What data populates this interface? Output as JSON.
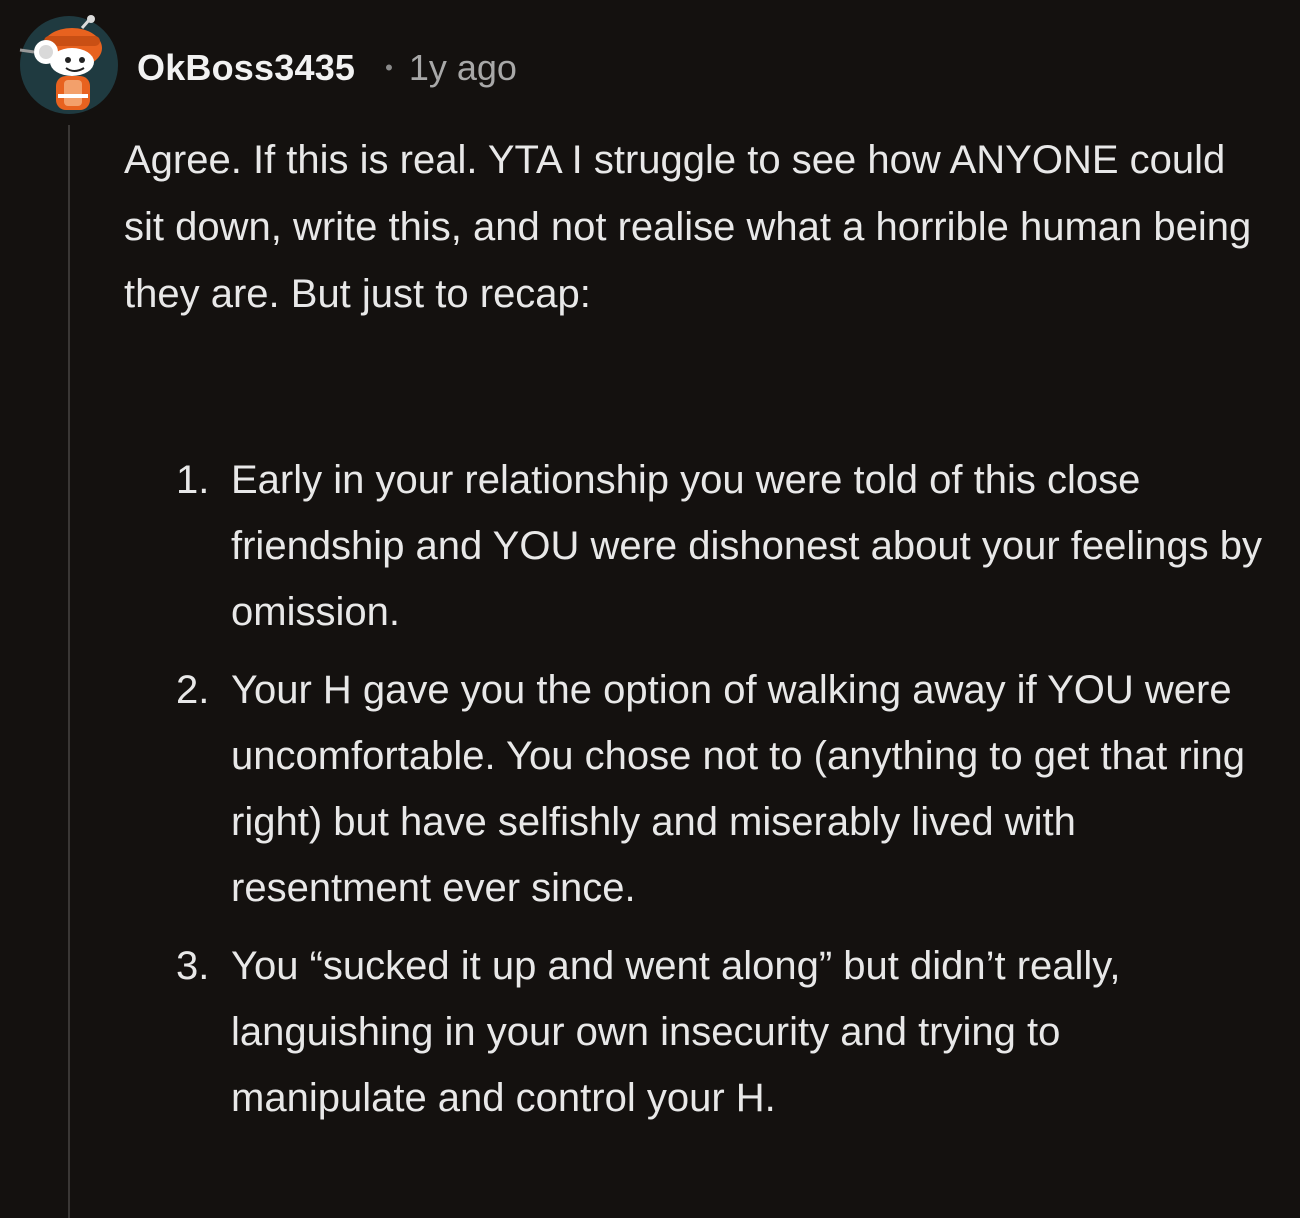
{
  "comment": {
    "username": "OkBoss3435",
    "separator": "•",
    "timestamp": "1y ago",
    "avatar_icon": "snoo-avatar-icon",
    "paragraph": "Agree. If this is real. YTA I struggle to see how ANYONE could sit down, write this, and not realise what a horrible human being they are. But just to recap:",
    "list": [
      {
        "number": "1.",
        "text": "Early in your relationship you were told of this close friendship and YOU were dishonest about your feelings by omission."
      },
      {
        "number": "2.",
        "text": "Your H gave you the option of walking away if YOU were uncomfortable. You chose not to (anything to get that ring right) but have selfishly and miserably lived with resentment ever since."
      },
      {
        "number": "3.",
        "text": "You “sucked it up and went along” but didn’t really, languishing in your own insecurity and trying to manipulate and control your H."
      }
    ]
  },
  "colors": {
    "background": "#14110f",
    "text": "#e8e8e8",
    "meta": "#a8a8a8",
    "avatar_accent": "#e8621f"
  }
}
